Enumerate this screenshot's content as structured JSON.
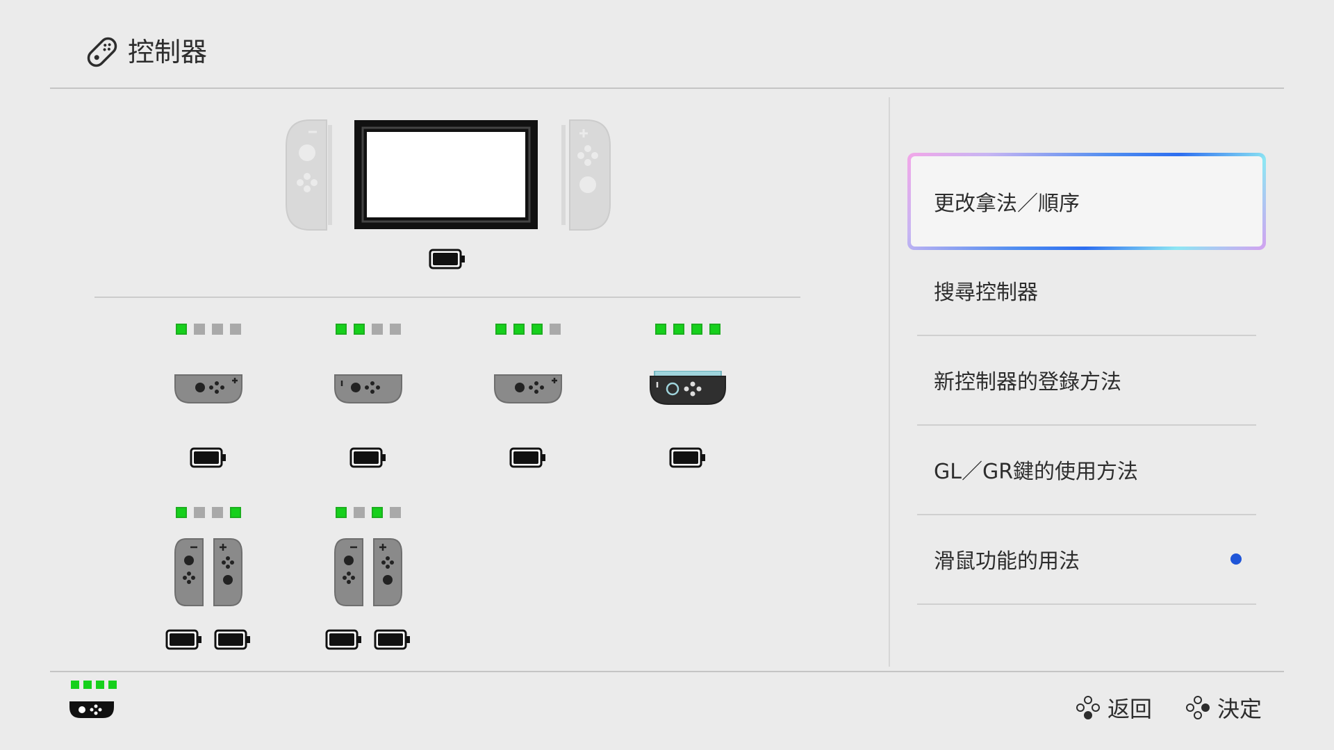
{
  "header": {
    "title": "控制器",
    "icon": "controller-icon"
  },
  "menu": {
    "items": [
      {
        "label": "更改拿法／順序",
        "selected": true
      },
      {
        "label": "搜尋控制器"
      },
      {
        "label": "新控制器的登錄方法"
      },
      {
        "label": "GL／GR鍵的使用方法"
      },
      {
        "label": "滑鼠功能的用法",
        "has_new_indicator": true
      }
    ]
  },
  "console": {
    "icon": "switch-console-icon",
    "battery": "full"
  },
  "players": [
    {
      "slot": 1,
      "leds": [
        1,
        0,
        0,
        0
      ],
      "controller": "joycon-l-sideways-gray",
      "batteries": 1
    },
    {
      "slot": 2,
      "leds": [
        1,
        1,
        0,
        0
      ],
      "controller": "joycon-r-sideways-gray",
      "batteries": 1
    },
    {
      "slot": 3,
      "leds": [
        1,
        1,
        1,
        0
      ],
      "controller": "joycon-l-sideways-gray",
      "batteries": 1
    },
    {
      "slot": 4,
      "leds": [
        1,
        1,
        1,
        1
      ],
      "controller": "joycon-r-sideways-black",
      "batteries": 1
    },
    {
      "slot": 5,
      "leds": [
        1,
        0,
        0,
        1
      ],
      "controller": "joycon-pair-gray",
      "batteries": 2
    },
    {
      "slot": 6,
      "leds": [
        1,
        0,
        1,
        0
      ],
      "controller": "joycon-pair-gray",
      "batteries": 2
    }
  ],
  "footer": {
    "current_controller_leds": [
      1,
      1,
      1,
      1
    ],
    "back_label": "返回",
    "confirm_label": "決定",
    "back_icon": "b-button-icon",
    "confirm_icon": "a-button-icon"
  },
  "colors": {
    "background": "#ebebeb",
    "led_on": "#16d01c",
    "led_off": "#a9a9a9",
    "selection_gradient_start": "#f3a6e8",
    "selection_gradient_mid": "#2d6ef0",
    "selection_gradient_end": "#8de6f3",
    "new_indicator": "#1f55d8"
  }
}
